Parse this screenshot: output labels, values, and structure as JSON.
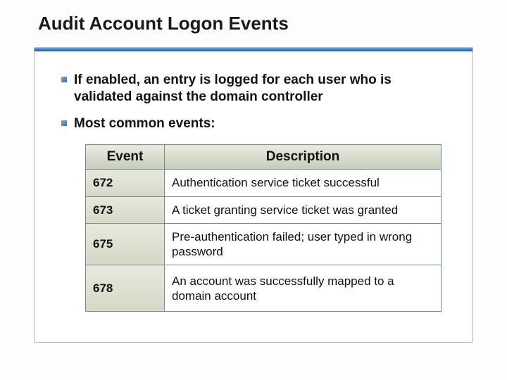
{
  "title": "Audit Account Logon Events",
  "bullets": [
    "If enabled, an entry is logged for each user who is validated against the domain controller",
    "Most common events:"
  ],
  "table": {
    "headers": {
      "event": "Event",
      "description": "Description"
    },
    "rows": [
      {
        "id": "672",
        "desc": "Authentication service ticket successful"
      },
      {
        "id": "673",
        "desc": "A ticket granting service ticket was granted"
      },
      {
        "id": "675",
        "desc": "Pre-authentication failed; user typed in wrong password"
      },
      {
        "id": "678",
        "desc": "An account was successfully mapped to a domain account"
      }
    ]
  }
}
